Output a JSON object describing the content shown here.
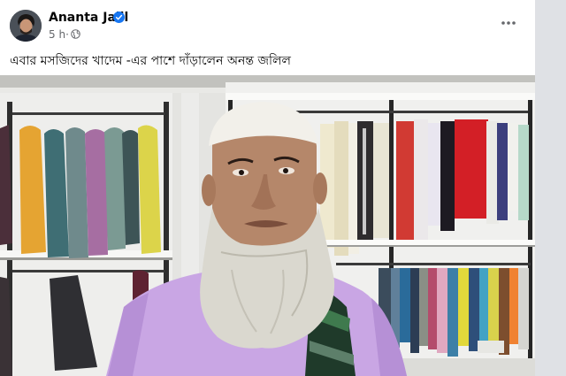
{
  "post": {
    "author_name": "Ananta Jalil",
    "time": "5 h",
    "meta_separator": "·",
    "caption": "এবার মসজিদের খাদেম -এর পাশে দাঁড়ালেন অনন্ত জলিল"
  },
  "icons": {
    "verified": "verified-badge-icon",
    "audience": "globe-icon",
    "more": "more-options-icon"
  },
  "colors": {
    "verified": "#1877f2",
    "secondary_text": "#65676b",
    "shirt": "#c8a5e4",
    "beard": "#dad8cf"
  }
}
